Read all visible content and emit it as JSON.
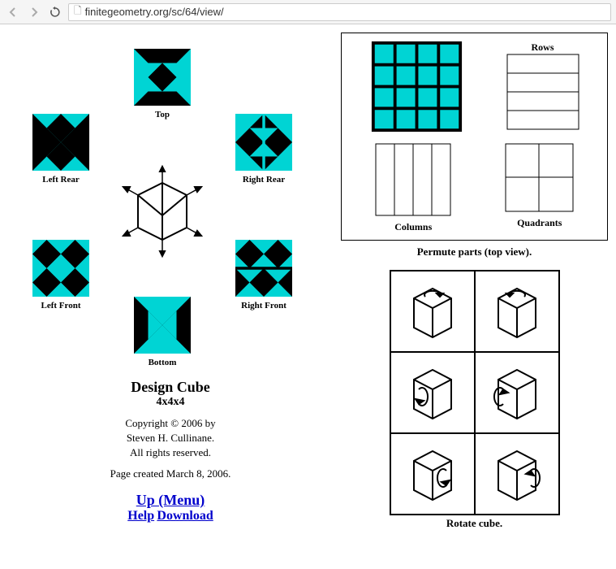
{
  "browser": {
    "url": "finitegeometry.org/sc/64/view/"
  },
  "faces": {
    "top": "Top",
    "leftRear": "Left Rear",
    "rightRear": "Right Rear",
    "leftFront": "Left Front",
    "rightFront": "Right Front",
    "bottom": "Bottom"
  },
  "info": {
    "title": "Design Cube",
    "subtitle": "4x4x4",
    "copyright1": "Copyright © 2006 by",
    "copyright2": "Steven H. Cullinane.",
    "copyright3": "All rights reserved.",
    "created": "Page created March 8, 2006."
  },
  "links": {
    "up": "Up (Menu)",
    "help": "Help",
    "download": "Download"
  },
  "permute": {
    "rows": "Rows",
    "columns": "Columns",
    "quadrants": "Quadrants",
    "caption": "Permute parts (top view)."
  },
  "rotate": {
    "caption": "Rotate cube."
  }
}
